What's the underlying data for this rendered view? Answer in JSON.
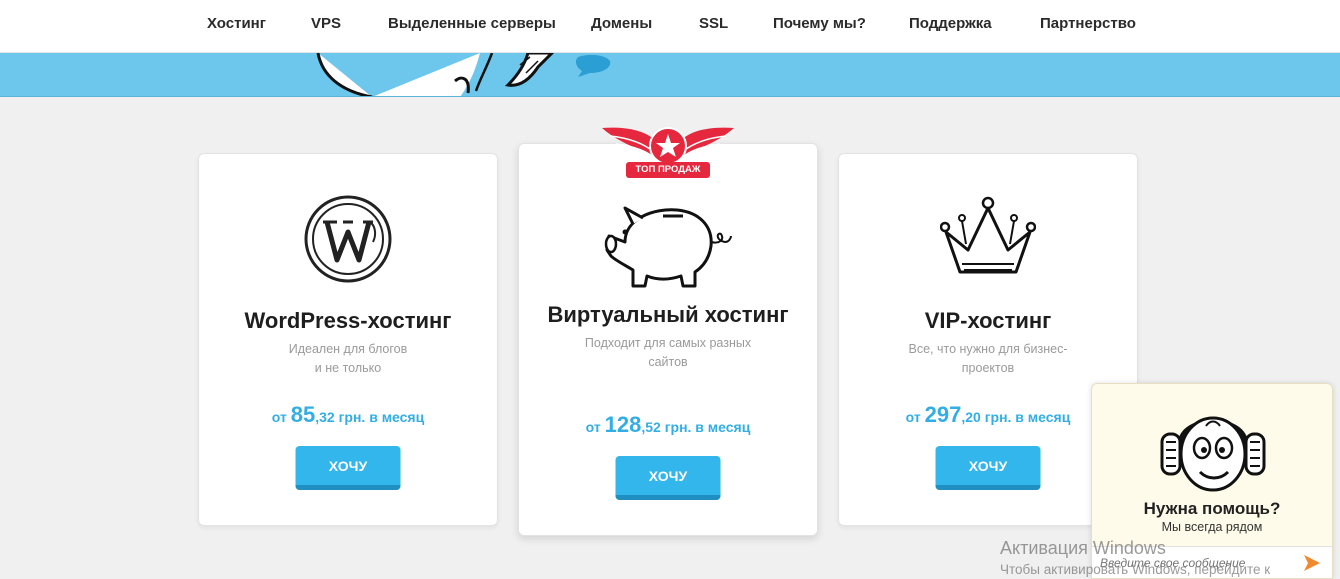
{
  "nav": {
    "items": [
      {
        "label": "Хостинг"
      },
      {
        "label": "VPS"
      },
      {
        "label": "Выделенные серверы"
      },
      {
        "label": "Домены"
      },
      {
        "label": "SSL"
      },
      {
        "label": "Почему мы?"
      },
      {
        "label": "Поддержка"
      },
      {
        "label": "Партнерство"
      }
    ]
  },
  "colors": {
    "accent": "#33b6ec",
    "banner": "#6dc7ec",
    "price": "#33aee4",
    "badge": "#e5283e"
  },
  "badge": {
    "label": "ТОП ПРОДАЖ"
  },
  "cards": [
    {
      "icon": "wordpress-icon",
      "title": "WordPress-хостинг",
      "desc_line1": "Идеален для блогов",
      "desc_line2": "и не только",
      "price_prefix": "от",
      "price_int": "85",
      "price_dec": ",32",
      "price_suffix": "грн. в месяц",
      "button": "ХОЧУ"
    },
    {
      "icon": "piggy-bank-icon",
      "title": "Виртуальный хостинг",
      "desc_line1": "Подходит для самых разных",
      "desc_line2": "сайтов",
      "price_prefix": "от",
      "price_int": "128",
      "price_dec": ",52",
      "price_suffix": "грн. в месяц",
      "button": "ХОЧУ"
    },
    {
      "icon": "crown-icon",
      "title": "VIP-хостинг",
      "desc_line1": "Все, что нужно для бизнес-",
      "desc_line2": "проектов",
      "price_prefix": "от",
      "price_int": "297",
      "price_dec": ",20",
      "price_suffix": "грн. в месяц",
      "button": "ХОЧУ"
    }
  ],
  "chat": {
    "title": "Нужна помощь?",
    "subtitle": "Мы всегда рядом",
    "placeholder": "Введите свое сообщение",
    "icon": "headphones-mascot-icon"
  },
  "watermark": {
    "line1": "Активация Windows",
    "line2": "Чтобы активировать Windows, перейдите к"
  }
}
